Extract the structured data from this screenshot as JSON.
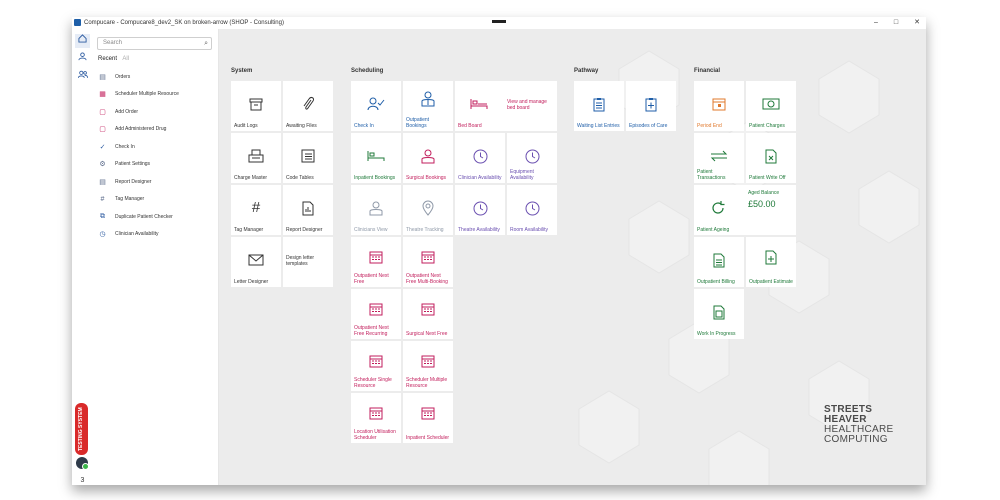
{
  "window": {
    "title": "Compucare - Compucare8_dev2_SK on broken-arrow (SHOP - Consulting)",
    "controls": [
      "–",
      "□",
      "✕"
    ]
  },
  "rail": {
    "testing_badge": "TESTING SYSTEM",
    "count": "3"
  },
  "sidebar": {
    "search_placeholder": "Search",
    "tabs": [
      "Recent",
      "All"
    ],
    "recent": [
      {
        "label": "Orders",
        "icon": "orders-icon"
      },
      {
        "label": "Scheduler Multiple Resource",
        "icon": "calendar-icon"
      },
      {
        "label": "Add Order",
        "icon": "order-icon"
      },
      {
        "label": "Add Administered Drug",
        "icon": "drug-icon"
      },
      {
        "label": "Check In",
        "icon": "check-in-icon"
      },
      {
        "label": "Patient Settings",
        "icon": "patient-settings-icon"
      },
      {
        "label": "Report Designer",
        "icon": "report-icon"
      },
      {
        "label": "Tag Manager",
        "icon": "hash-icon"
      },
      {
        "label": "Duplicate Patient Checker",
        "icon": "duplicate-icon"
      },
      {
        "label": "Clinician Availability",
        "icon": "clock-icon"
      }
    ]
  },
  "sections": {
    "system": "System",
    "scheduling": "Scheduling",
    "pathway": "Pathway",
    "financial": "Financial"
  },
  "tiles": {
    "audit_logs": "Audit Logs",
    "awaiting_files": "Awaiting Files",
    "charge_master": "Charge Master",
    "code_tables": "Code Tables",
    "tag_manager": "Tag Manager",
    "report_designer": "Report Designer",
    "letter_designer": "Letter Designer",
    "design_letter_templates": "Design letter templates",
    "check_in": "Check In",
    "outpatient_bookings": "Outpatient Bookings",
    "bed_board": "Bed Board",
    "view_bed_board": "View and manage bed board",
    "inpatient_bookings": "Inpatient Bookings",
    "surgical_bookings": "Surgical Bookings",
    "clinician_availability": "Clinician Availability",
    "equipment_availability": "Equipment Availability",
    "clinicians_view": "Clinicians View",
    "theatre_tracking": "Theatre Tracking",
    "theatre_availability": "Theatre Availability",
    "room_availability": "Room Availability",
    "outpatient_next_free": "Outpatient Next Free",
    "outpatient_next_free_multi": "Outpatient Next Free Multi-Booking",
    "outpatient_next_free_recurring": "Outpatient Next Free Recurring",
    "surgical_next_free": "Surgical Next Free",
    "scheduler_single": "Scheduler Single Resource",
    "scheduler_multiple": "Scheduler Multiple Resource",
    "location_utilisation": "Location Utilisation Scheduler",
    "inpatient_scheduler": "Inpatient Scheduler",
    "waiting_list": "Waiting List Entries",
    "episodes_of_care": "Episodes of Care",
    "period_end": "Period End",
    "patient_charges": "Patient Charges",
    "patient_transactions": "Patient Transactions",
    "patient_write_off": "Patient Write Off",
    "patient_ageing": "Patient Ageing",
    "aged_balance_label": "Aged Balance",
    "aged_balance_value": "£50.00",
    "outpatient_billing": "Outpatient Billing",
    "outpatient_estimate": "Outpatient Estimate",
    "work_in_progress": "Work In Progress"
  },
  "logo": {
    "line1": "STREETS",
    "line2": "HEAVER",
    "line3": "HEALTHCARE",
    "line4": "COMPUTING"
  },
  "colors": {
    "accent_blue": "#1f5ea8",
    "pink": "#c21e5c",
    "purple": "#6a4fb0",
    "green": "#1f7a3a",
    "orange": "#e0782b",
    "testing_red": "#d92a2a"
  }
}
